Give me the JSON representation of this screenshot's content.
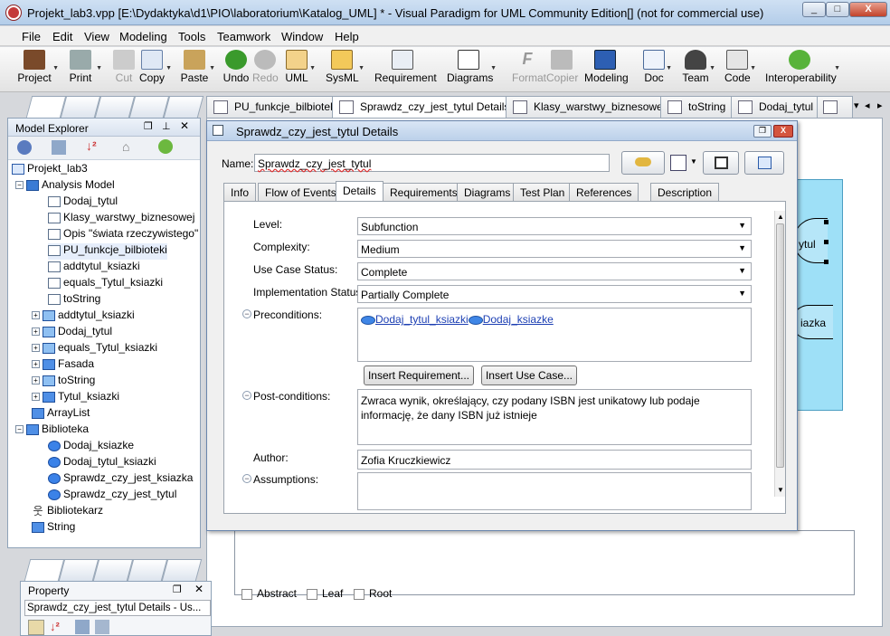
{
  "window": {
    "title": "Projekt_lab3.vpp [E:\\Dydaktyka\\d1\\PIO\\laboratorium\\Katalog_UML] * - Visual Paradigm for UML Community Edition[] (not for commercial use)",
    "min": "_",
    "max": "□",
    "close": "X"
  },
  "menu": [
    "File",
    "Edit",
    "View",
    "Modeling",
    "Tools",
    "Teamwork",
    "Window",
    "Help"
  ],
  "toolbar": [
    "Project",
    "Print",
    "Cut",
    "Copy",
    "Paste",
    "Undo",
    "Redo",
    "UML",
    "SysML",
    "Requirement",
    "Diagrams",
    "Format",
    "Copier",
    "Modeling",
    "Doc",
    "Team",
    "Code",
    "Interoperability"
  ],
  "model_explorer": {
    "title": "Model Explorer",
    "tree": [
      {
        "label": "Projekt_lab3"
      },
      {
        "label": "Analysis Model"
      },
      {
        "label": "Dodaj_tytul"
      },
      {
        "label": "Klasy_warstwy_biznesowej"
      },
      {
        "label": "Opis \"świata rzeczywistego\""
      },
      {
        "label": "PU_funkcje_bilbioteki"
      },
      {
        "label": "addtytul_ksiazki"
      },
      {
        "label": "equals_Tytul_ksiazki"
      },
      {
        "label": "toString"
      },
      {
        "label": "addtytul_ksiazki"
      },
      {
        "label": "Dodaj_tytul"
      },
      {
        "label": "equals_Tytul_ksiazki"
      },
      {
        "label": "Fasada"
      },
      {
        "label": "toString"
      },
      {
        "label": "Tytul_ksiazki"
      },
      {
        "label": "ArrayList"
      },
      {
        "label": "Biblioteka"
      },
      {
        "label": "Dodaj_ksiazke"
      },
      {
        "label": "Dodaj_tytul_ksiazki"
      },
      {
        "label": "Sprawdz_czy_jest_ksiazka"
      },
      {
        "label": "Sprawdz_czy_jest_tytul"
      },
      {
        "label": "Bibliotekarz"
      },
      {
        "label": "String"
      }
    ]
  },
  "doc_tabs": [
    "PU_funkcje_bilbioteki",
    "Sprawdz_czy_jest_tytul Details",
    "Klasy_warstwy_biznesowej",
    "toString",
    "Dodaj_tytul"
  ],
  "dialog": {
    "title": "Sprawdz_czy_jest_tytul Details",
    "name_label": "Name:",
    "name_value": "Sprawdz_czy_jest_tytul",
    "tabs": [
      "Info",
      "Flow of Events",
      "Details",
      "Requirements",
      "Diagrams",
      "Test Plan",
      "References",
      "Description"
    ],
    "level_label": "Level:",
    "level_value": "Subfunction",
    "complexity_label": "Complexity:",
    "complexity_value": "Medium",
    "status_label": "Use Case Status:",
    "status_value": "Complete",
    "impl_label": "Implementation Status:",
    "impl_value": "Partially Complete",
    "pre_label": "Preconditions:",
    "pre_link1": "Dodaj_tytul_ksiazki",
    "pre_link2": "Dodaj_ksiazke",
    "insert_req": "Insert Requirement...",
    "insert_uc": "Insert Use Case...",
    "post_label": "Post-conditions:",
    "post_value": "Zwraca wynik, określający, czy podany ISBN jest unikatowy lub podaje informację, że dany ISBN już istnieje",
    "author_label": "Author:",
    "author_value": "Zofia Kruczkiewicz",
    "assumptions_label": "Assumptions:"
  },
  "canvas": {
    "shape_text1": "ytul",
    "shape_text2": "iazka",
    "abstract": "Abstract",
    "leaf": "Leaf",
    "root": "Root"
  },
  "property": {
    "title": "Property",
    "combo": "Sprawdz_czy_jest_tytul Details - Us..."
  }
}
